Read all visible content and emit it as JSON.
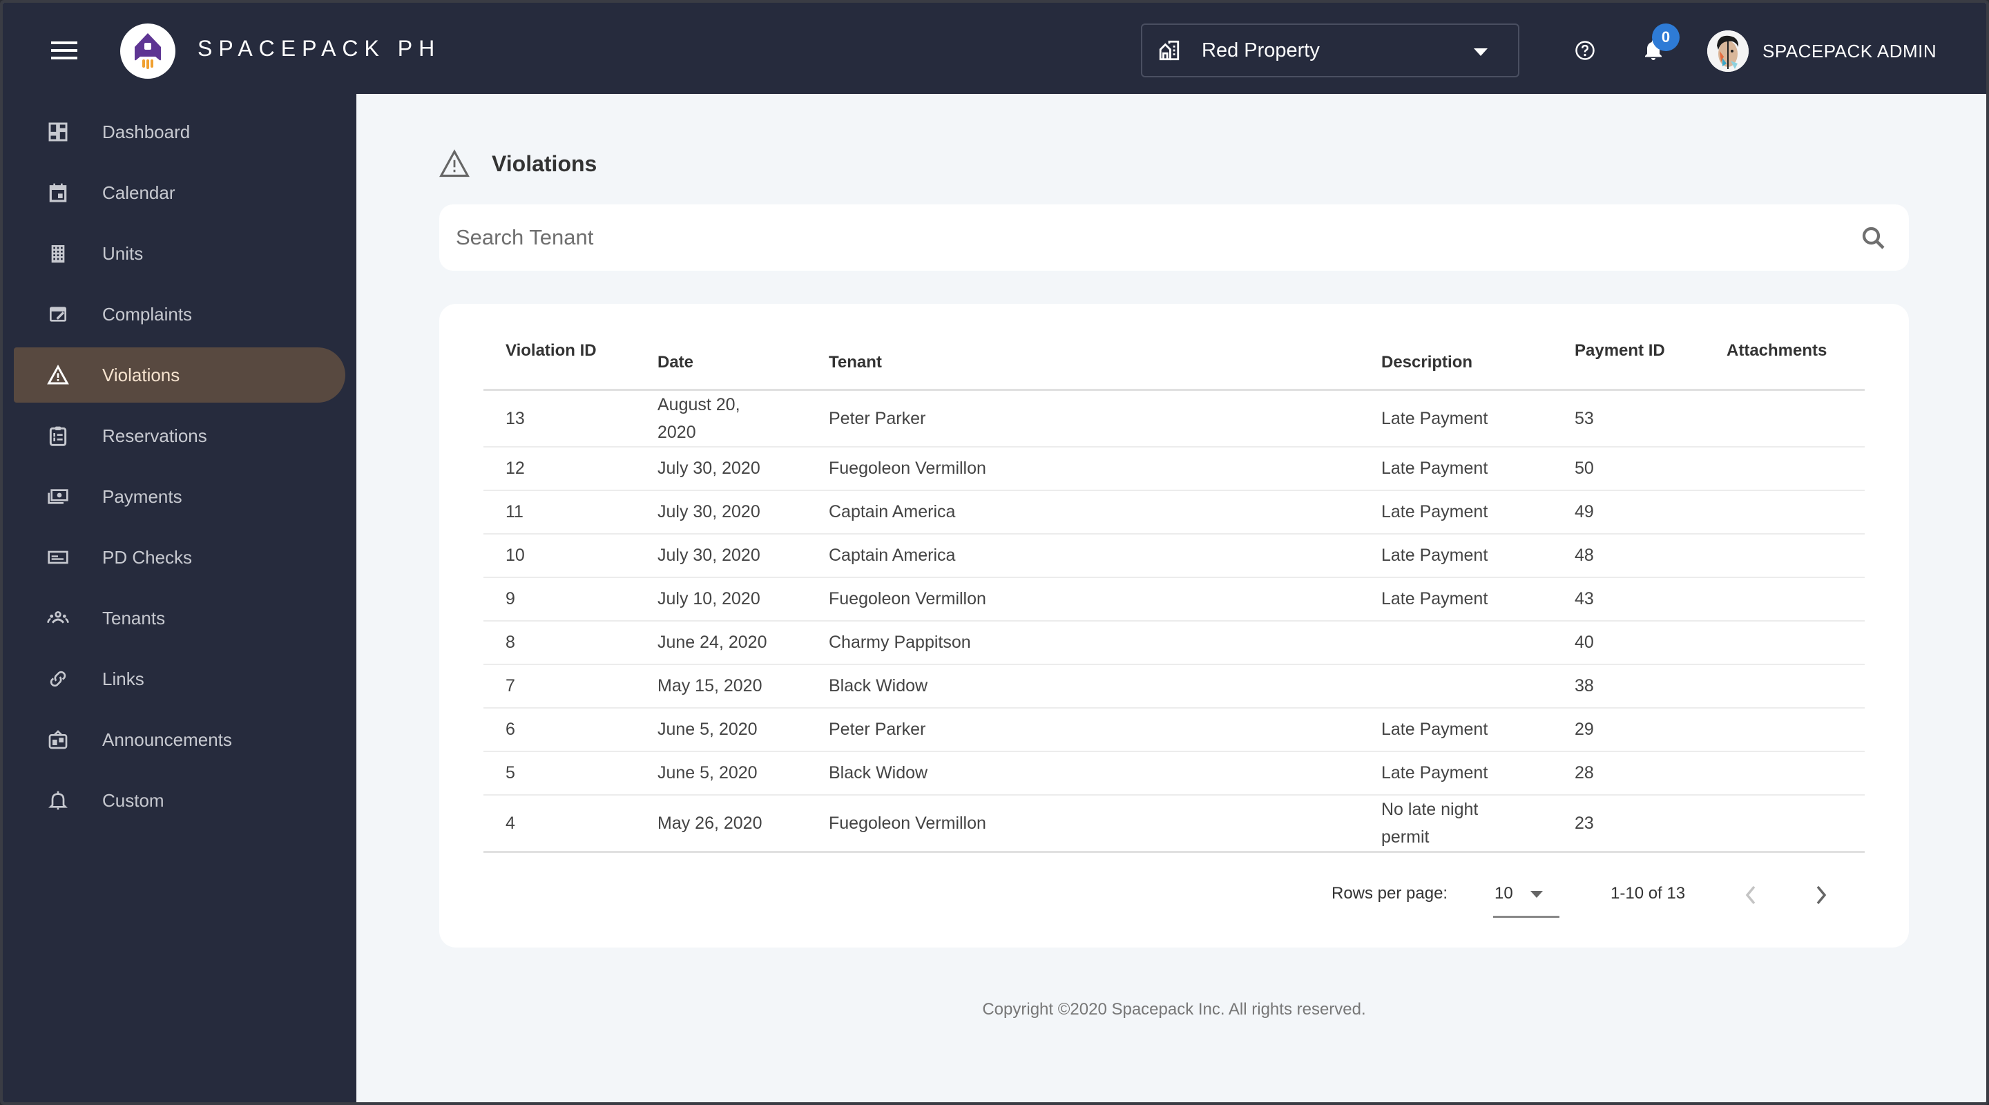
{
  "header": {
    "brand": "SPACEPACK PH",
    "property_selector": {
      "value": "Red Property"
    },
    "notifications": {
      "count": "0"
    },
    "user": {
      "name": "SPACEPACK ADMIN"
    }
  },
  "sidebar": {
    "items": [
      {
        "label": "Dashboard",
        "icon": "dashboard-icon"
      },
      {
        "label": "Calendar",
        "icon": "calendar-icon"
      },
      {
        "label": "Units",
        "icon": "building-icon"
      },
      {
        "label": "Complaints",
        "icon": "complaint-icon"
      },
      {
        "label": "Violations",
        "icon": "warning-icon",
        "active": true
      },
      {
        "label": "Reservations",
        "icon": "clipboard-list-icon"
      },
      {
        "label": "Payments",
        "icon": "money-icon"
      },
      {
        "label": "PD Checks",
        "icon": "check-card-icon"
      },
      {
        "label": "Tenants",
        "icon": "people-icon"
      },
      {
        "label": "Links",
        "icon": "link-icon"
      },
      {
        "label": "Announcements",
        "icon": "announcement-board-icon"
      },
      {
        "label": "Custom",
        "icon": "bell-outline-icon"
      }
    ]
  },
  "page": {
    "title": "Violations",
    "search": {
      "placeholder": "Search Tenant",
      "value": ""
    }
  },
  "table": {
    "columns": [
      "Violation ID",
      "Date",
      "Tenant",
      "Description",
      "Payment ID",
      "Attachments"
    ],
    "rows": [
      {
        "id": "13",
        "date": "August 20, 2020",
        "tenant": "Peter Parker",
        "description": "Late Payment",
        "payment_id": "53",
        "attachments": ""
      },
      {
        "id": "12",
        "date": "July 30, 2020",
        "tenant": "Fuegoleon Vermillon",
        "description": "Late Payment",
        "payment_id": "50",
        "attachments": ""
      },
      {
        "id": "11",
        "date": "July 30, 2020",
        "tenant": "Captain America",
        "description": "Late Payment",
        "payment_id": "49",
        "attachments": ""
      },
      {
        "id": "10",
        "date": "July 30, 2020",
        "tenant": "Captain America",
        "description": "Late Payment",
        "payment_id": "48",
        "attachments": ""
      },
      {
        "id": "9",
        "date": "July 10, 2020",
        "tenant": "Fuegoleon Vermillon",
        "description": "Late Payment",
        "payment_id": "43",
        "attachments": ""
      },
      {
        "id": "8",
        "date": "June 24, 2020",
        "tenant": "Charmy Pappitson",
        "description": "",
        "payment_id": "40",
        "attachments": ""
      },
      {
        "id": "7",
        "date": "May 15, 2020",
        "tenant": "Black Widow",
        "description": "",
        "payment_id": "38",
        "attachments": ""
      },
      {
        "id": "6",
        "date": "June 5, 2020",
        "tenant": "Peter Parker",
        "description": "Late Payment",
        "payment_id": "29",
        "attachments": ""
      },
      {
        "id": "5",
        "date": "June 5, 2020",
        "tenant": "Black Widow",
        "description": "Late Payment",
        "payment_id": "28",
        "attachments": ""
      },
      {
        "id": "4",
        "date": "May 26, 2020",
        "tenant": "Fuegoleon Vermillon",
        "description": "No late night permit",
        "payment_id": "23",
        "attachments": ""
      }
    ]
  },
  "pagination": {
    "rows_per_page_label": "Rows per page:",
    "rows_per_page": "10",
    "range": "1-10 of 13"
  },
  "footer": {
    "text": "Copyright ©2020 Spacepack Inc. All rights reserved."
  },
  "colors": {
    "topbar": "#262b3d",
    "sidebar_active": "#584940",
    "badge": "#2e7bd6",
    "logo_purple": "#5e3593",
    "logo_orange": "#f0a030"
  }
}
